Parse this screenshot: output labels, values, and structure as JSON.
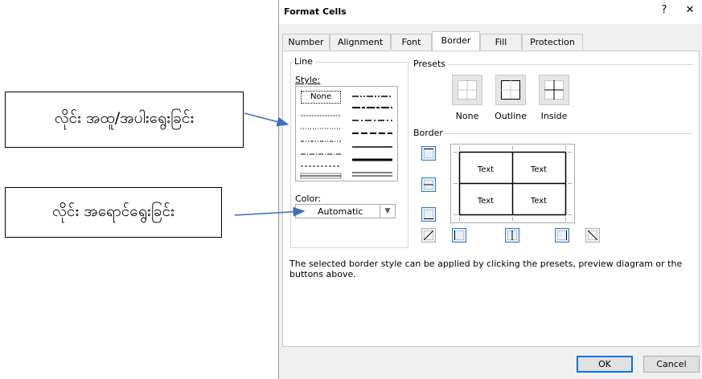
{
  "annotations": {
    "style_callout": "လိုင်း အထူ/အပါးရွေးခြင်း",
    "color_callout": "လိုင်း အရောင်ရွေးခြင်း"
  },
  "dialog": {
    "title": "Format Cells",
    "help": "?",
    "close": "✕",
    "tabs": [
      "Number",
      "Alignment",
      "Font",
      "Border",
      "Fill",
      "Protection"
    ],
    "active_tab": "Border",
    "line": {
      "group_label": "Line",
      "style_label": "Style:",
      "none_label": "None",
      "color_label": "Color:",
      "color_value": "Automatic"
    },
    "presets": {
      "group_label": "Presets",
      "items": [
        "None",
        "Outline",
        "Inside"
      ]
    },
    "border": {
      "group_label": "Border",
      "preview_cells": [
        "Text",
        "Text",
        "Text",
        "Text"
      ]
    },
    "description": "The selected border style can be applied by clicking the presets, preview diagram or the buttons above.",
    "buttons": {
      "ok": "OK",
      "cancel": "Cancel"
    }
  },
  "colors": {
    "accent": "#2b78d3",
    "arrow": "#3a6fc0"
  }
}
